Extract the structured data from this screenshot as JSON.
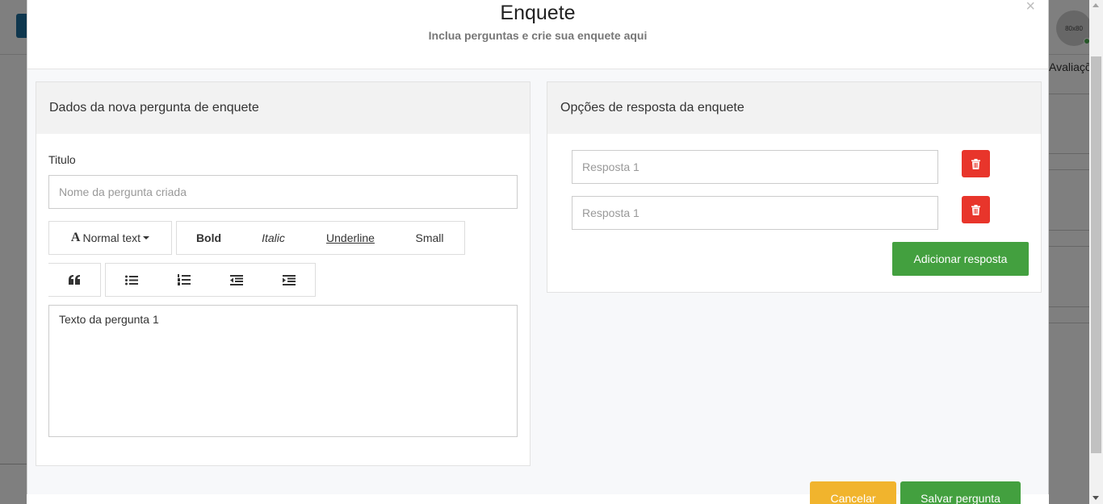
{
  "background": {
    "avatar_text": "80x80",
    "tab_label": "Avaliações"
  },
  "modal": {
    "title": "Enquete",
    "subtitle": "Inclua perguntas e crie sua enquete aqui",
    "close_glyph": "×"
  },
  "question_panel": {
    "heading": "Dados da nova pergunta de enquete",
    "title_label": "Titulo",
    "title_placeholder": "Nome da pergunta criada",
    "toolbar": {
      "font_glyph": "A",
      "font_size_label": "Normal text",
      "bold_label": "Bold",
      "italic_label": "Italic",
      "underline_label": "Underline",
      "small_label": "Small"
    },
    "editor_text": "Texto da pergunta 1"
  },
  "answers_panel": {
    "heading": "Opções de resposta da enquete",
    "answers": [
      {
        "placeholder": "Resposta 1"
      },
      {
        "placeholder": "Resposta 1"
      }
    ],
    "add_label": "Adicionar resposta"
  },
  "footer": {
    "cancel_label": "Cancelar",
    "save_label": "Salvar pergunta"
  },
  "colors": {
    "danger": "#e8352b",
    "success": "#43a03f",
    "warning": "#f1b42d"
  }
}
